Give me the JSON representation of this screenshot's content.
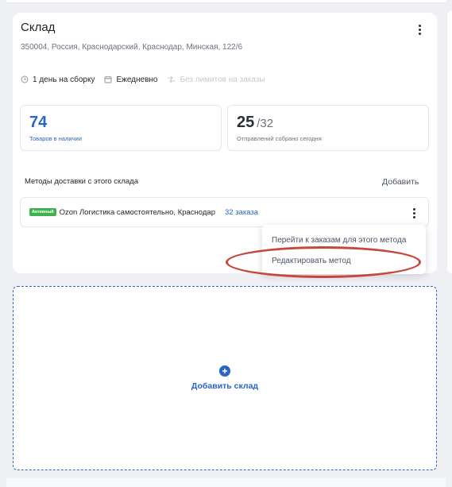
{
  "warehouse": {
    "title": "Склад",
    "address": "350004, Россия, Краснодарский, Краснодар, Минская, 122/6",
    "meta": {
      "assembly": "1 день на сборку",
      "schedule": "Ежедневно",
      "limits": "Без лимитов на заказы"
    },
    "stats": {
      "in_stock_value": "74",
      "in_stock_label": "Товаров в наличии",
      "collected_value": "25",
      "collected_total": "/32",
      "collected_label": "Отправлений собрано сегодня"
    },
    "methods": {
      "title": "Методы доставки с этого склада",
      "add_label": "Добавить",
      "items": [
        {
          "badge": "Активный",
          "name": "Ozon Логистика самостоятельно, Краснодар",
          "orders": "32 заказа"
        }
      ]
    },
    "dropdown": {
      "items": [
        "Перейти к заказам для этого метода",
        "Редактировать метод"
      ]
    }
  },
  "add_warehouse": {
    "label": "Добавить склад"
  },
  "colors": {
    "accent": "#2a63c9",
    "active_badge": "#3fb14f",
    "highlight": "#c8473c"
  }
}
